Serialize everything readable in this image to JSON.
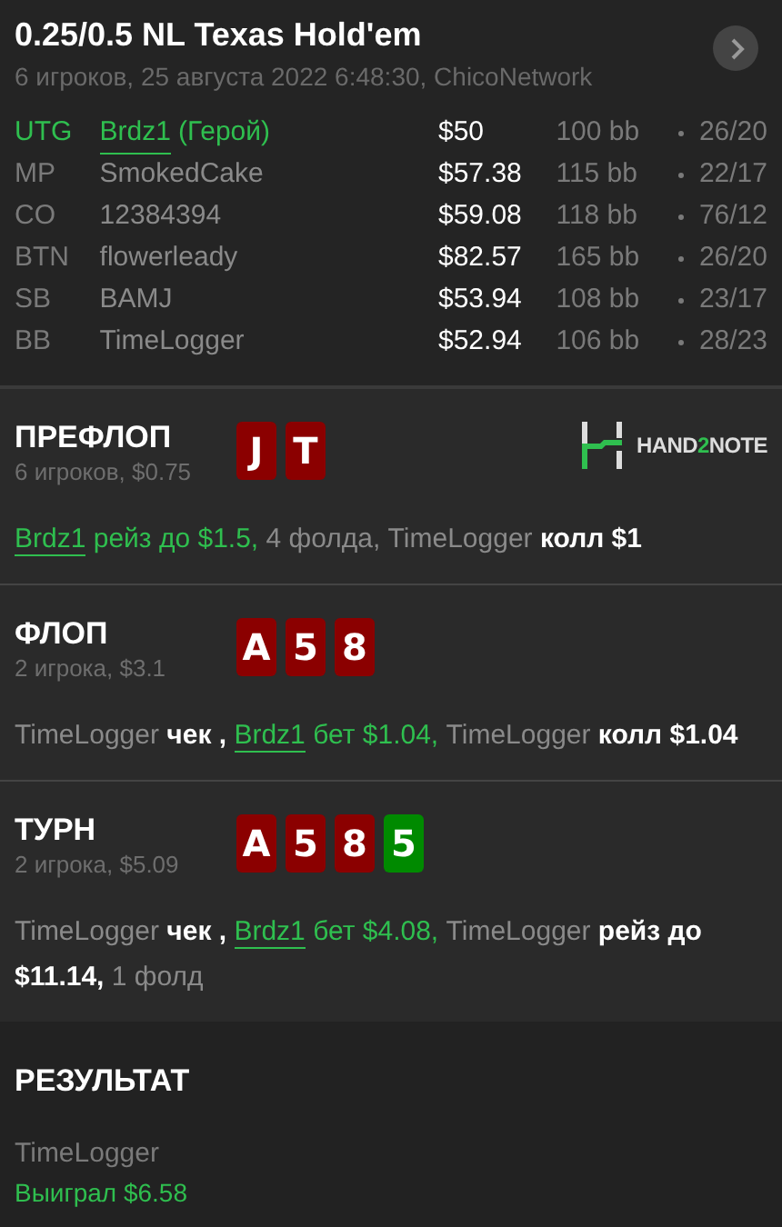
{
  "header": {
    "title": "0.25/0.5 NL Texas Hold'em",
    "subtitle": "6 игроков, 25 августа 2022 6:48:30, ChicoNetwork"
  },
  "players": [
    {
      "position": "UTG",
      "name": "Brdz1",
      "tag": "(Герой)",
      "hero": true,
      "stack": "$50",
      "bb": "100 bb",
      "ratio": "26/20"
    },
    {
      "position": "MP",
      "name": "SmokedCake",
      "hero": false,
      "stack": "$57.38",
      "bb": "115 bb",
      "ratio": "22/17"
    },
    {
      "position": "CO",
      "name": "12384394",
      "hero": false,
      "stack": "$59.08",
      "bb": "118 bb",
      "ratio": "76/12"
    },
    {
      "position": "BTN",
      "name": "flowerleady",
      "hero": false,
      "stack": "$82.57",
      "bb": "165 bb",
      "ratio": "26/20"
    },
    {
      "position": "SB",
      "name": "BAMJ",
      "hero": false,
      "stack": "$53.94",
      "bb": "108 bb",
      "ratio": "23/17"
    },
    {
      "position": "BB",
      "name": "TimeLogger",
      "hero": false,
      "stack": "$52.94",
      "bb": "106 bb",
      "ratio": "28/23"
    }
  ],
  "streets": [
    {
      "title": "ПРЕФЛОП",
      "info": "6 игроков, $0.75",
      "cards": [
        {
          "rank": "J",
          "color": "#8b0000"
        },
        {
          "rank": "T",
          "color": "#8b0000"
        }
      ],
      "logo": [
        {
          "text": "HAND",
          "accent": false
        },
        {
          "text": "2",
          "accent": true
        },
        {
          "text": "NOTE",
          "accent": false
        }
      ],
      "actions": [
        {
          "kind": "hero-link",
          "text": "Brdz1"
        },
        {
          "kind": "hero",
          "text": " рейз до $1.5,"
        },
        {
          "kind": "player",
          "text": " 4 фолда, TimeLogger"
        },
        {
          "kind": "action",
          "text": " колл $1"
        }
      ]
    },
    {
      "title": "ФЛОП",
      "info": "2 игрока, $3.1",
      "cards": [
        {
          "rank": "A",
          "color": "#8b0000"
        },
        {
          "rank": "5",
          "color": "#8b0000"
        },
        {
          "rank": "8",
          "color": "#8b0000"
        }
      ],
      "actions": [
        {
          "kind": "player",
          "text": "TimeLogger"
        },
        {
          "kind": "action",
          "text": " чек , "
        },
        {
          "kind": "hero-link",
          "text": "Brdz1"
        },
        {
          "kind": "hero",
          "text": " бет $1.04,"
        },
        {
          "kind": "player",
          "text": " TimeLogger"
        },
        {
          "kind": "action",
          "text": " колл $1.04"
        }
      ]
    },
    {
      "title": "ТУРН",
      "info": "2 игрока, $5.09",
      "cards": [
        {
          "rank": "A",
          "color": "#8b0000"
        },
        {
          "rank": "5",
          "color": "#8b0000"
        },
        {
          "rank": "8",
          "color": "#8b0000"
        },
        {
          "rank": "5",
          "color": "#008a00"
        }
      ],
      "actions": [
        {
          "kind": "player",
          "text": "TimeLogger"
        },
        {
          "kind": "action",
          "text": " чек , "
        },
        {
          "kind": "hero-link",
          "text": "Brdz1"
        },
        {
          "kind": "hero",
          "text": " бет $4.08,"
        },
        {
          "kind": "player",
          "text": " TimeLogger"
        },
        {
          "kind": "action",
          "text": " рейз до $11.14,"
        },
        {
          "kind": "player",
          "text": " 1 фолд"
        }
      ]
    }
  ],
  "result": {
    "title": "РЕЗУЛЬТАТ",
    "winner": "TimeLogger",
    "outcome": "Выиграл $6.58"
  }
}
